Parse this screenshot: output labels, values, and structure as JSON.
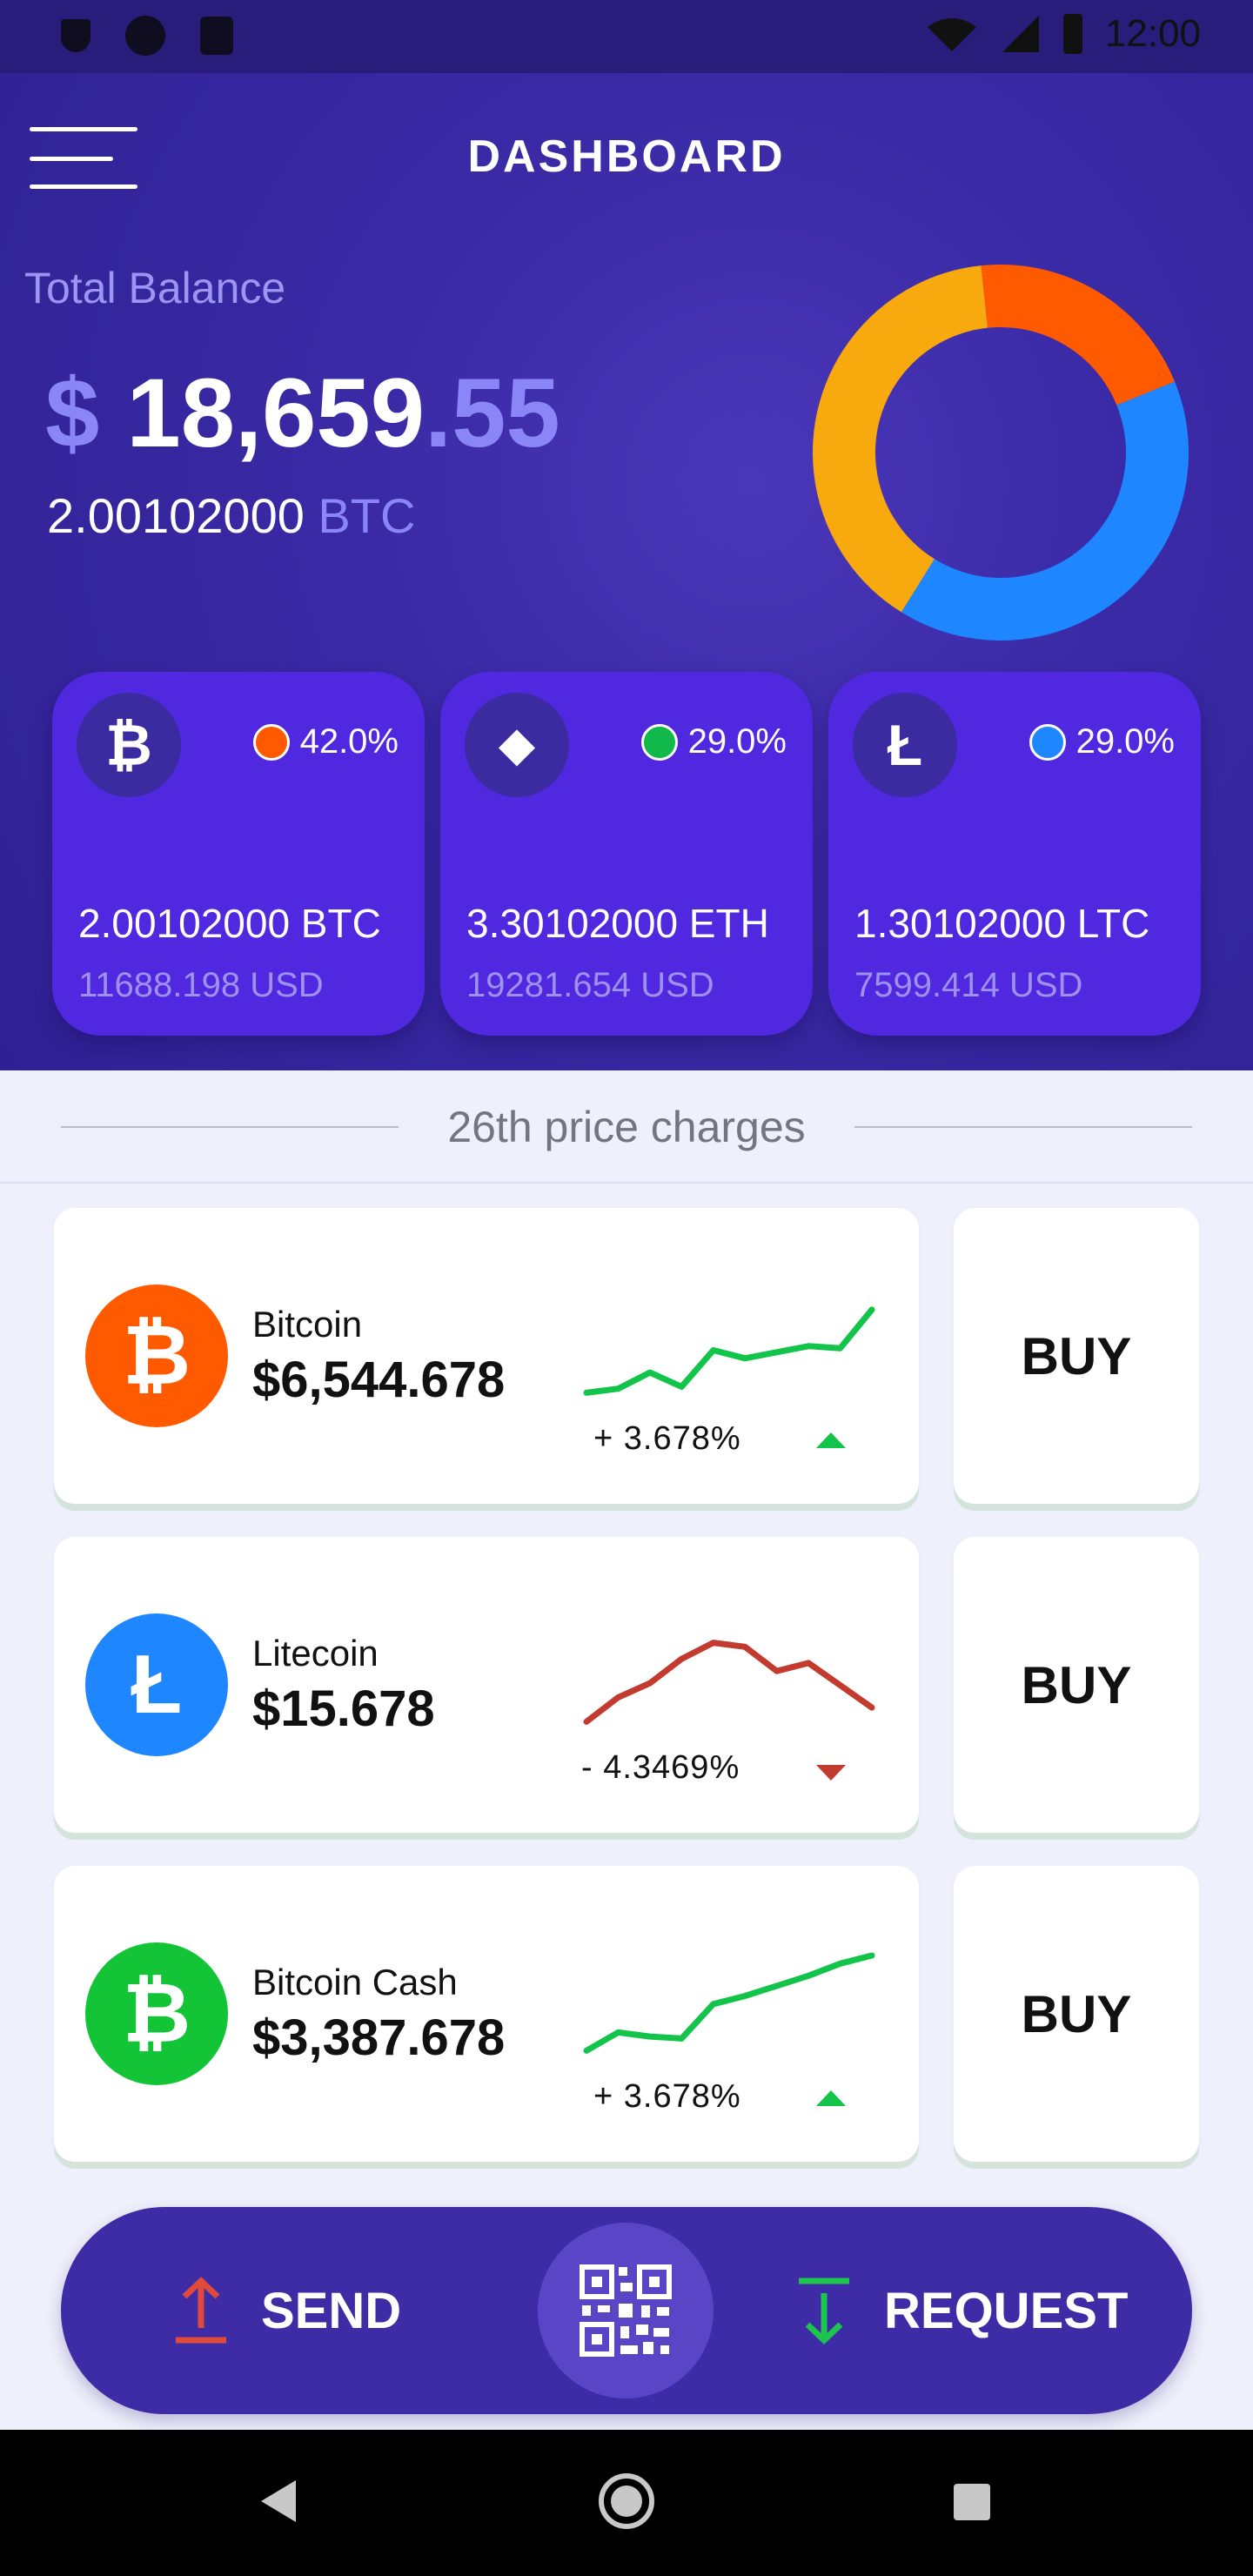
{
  "status_bar": {
    "time": "12:00"
  },
  "header": {
    "title": "DASHBOARD"
  },
  "balance": {
    "label": "Total Balance",
    "currency_symbol": "$",
    "integer_part": "18,659",
    "decimal_part": ".55",
    "btc_amount": "2.00102000",
    "btc_unit": "BTC"
  },
  "allocation_chart": {
    "segments": [
      {
        "color": "#ff5a00",
        "percent": 20.5
      },
      {
        "color": "#1e86ff",
        "percent": 40.0
      },
      {
        "color": "#f7a90d",
        "percent": 39.5
      }
    ]
  },
  "coins": [
    {
      "symbol_glyph": "₿",
      "percent": "42.0%",
      "dot_color": "#ff5a00",
      "amount": "2.00102000 BTC",
      "usd": "11688.198 USD"
    },
    {
      "symbol_glyph": "◆",
      "percent": "29.0%",
      "dot_color": "#11b84a",
      "amount": "3.30102000 ETH",
      "usd": "19281.654 USD"
    },
    {
      "symbol_glyph": "Ł",
      "percent": "29.0%",
      "dot_color": "#1e86ff",
      "amount": "1.30102000 LTC",
      "usd": "7599.414 USD"
    }
  ],
  "section": {
    "title": "26th price charges"
  },
  "prices": [
    {
      "name": "Bitcoin",
      "price": "$6,544.678",
      "change": "+ 3.678%",
      "direction": "up",
      "icon_color": "#ff5a00",
      "icon_glyph": "₿",
      "line_color": "#12c44a",
      "buy_label": "BUY",
      "spark": [
        10,
        14,
        30,
        16,
        52,
        44,
        50,
        56,
        54,
        92
      ]
    },
    {
      "name": "Litecoin",
      "price": "$15.678",
      "change": "- 4.3469%",
      "direction": "down",
      "icon_color": "#1e86ff",
      "icon_glyph": "Ł",
      "line_color": "#c33a2f",
      "buy_label": "BUY",
      "spark": [
        10,
        34,
        48,
        72,
        88,
        84,
        60,
        68,
        46,
        24
      ]
    },
    {
      "name": "Bitcoin Cash",
      "price": "$3,387.678",
      "change": "+ 3.678%",
      "direction": "up",
      "icon_color": "#12c436",
      "icon_glyph": "₿",
      "line_color": "#12c44a",
      "buy_label": "BUY",
      "spark": [
        10,
        28,
        24,
        22,
        56,
        64,
        74,
        84,
        96,
        104
      ]
    }
  ],
  "actions": {
    "send_label": "SEND",
    "request_label": "REQUEST"
  }
}
